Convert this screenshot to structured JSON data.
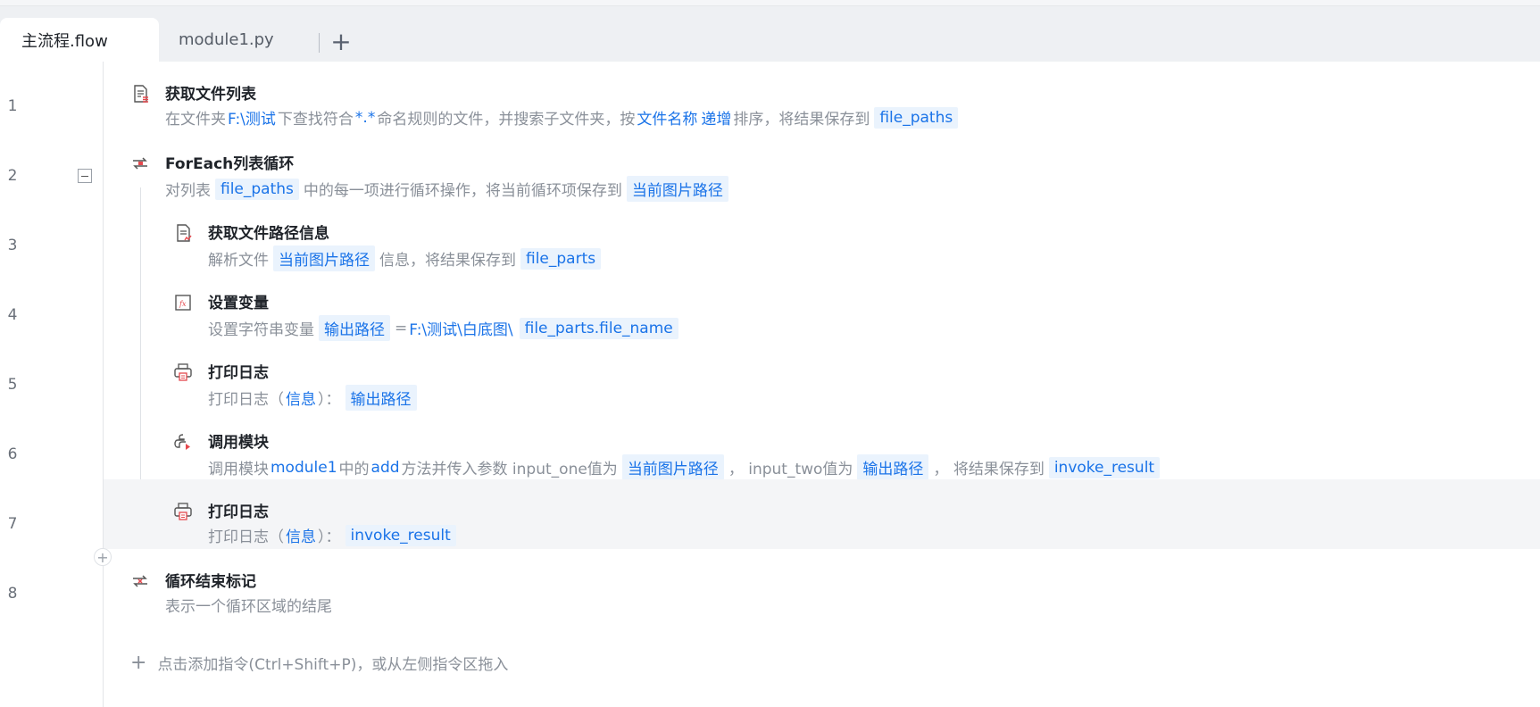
{
  "tabs": [
    {
      "label": "主流程.flow",
      "active": true
    },
    {
      "label": "module1.py",
      "active": false
    }
  ],
  "tab_add_label": "+",
  "colors": {
    "accent": "#1a73e8",
    "var_bg": "#eaf3fd",
    "muted": "#8a9099"
  },
  "steps": [
    {
      "num": "1",
      "icon": "file-list-icon",
      "title": "获取文件列表",
      "desc": [
        [
          "t",
          "在文件夹 "
        ],
        [
          "k",
          "F:\\测试"
        ],
        [
          "t",
          " 下查找符合 "
        ],
        [
          "k",
          "*.*"
        ],
        [
          "t",
          " 命名规则的文件，并搜索子文件夹，按 "
        ],
        [
          "k",
          "文件名称"
        ],
        [
          "k",
          "递增"
        ],
        [
          "t",
          " 排序，将结果保存到 "
        ],
        [
          "v",
          "file_paths"
        ]
      ]
    },
    {
      "num": "2",
      "icon": "loop-icon",
      "title": "ForEach列表循环",
      "desc": [
        [
          "t",
          "对列表 "
        ],
        [
          "v",
          "file_paths"
        ],
        [
          "t",
          " 中的每一项进行循环操作，将当前循环项保存到 "
        ],
        [
          "v",
          "当前图片路径"
        ]
      ]
    },
    {
      "num": "3",
      "icon": "file-path-icon",
      "title": "获取文件路径信息",
      "desc": [
        [
          "t",
          "解析文件 "
        ],
        [
          "v",
          "当前图片路径"
        ],
        [
          "t",
          " 信息，将结果保存到 "
        ],
        [
          "v",
          "file_parts"
        ]
      ]
    },
    {
      "num": "4",
      "icon": "function-icon",
      "title": "设置变量",
      "desc": [
        [
          "t",
          "设置字符串变量 "
        ],
        [
          "v",
          "输出路径"
        ],
        [
          "t",
          " = "
        ],
        [
          "k",
          "F:\\测试\\白底图\\"
        ],
        [
          "v",
          "file_parts.file_name"
        ]
      ]
    },
    {
      "num": "5",
      "icon": "print-log-icon",
      "title": "打印日志",
      "desc": [
        [
          "t",
          "打印日志（ "
        ],
        [
          "k",
          "信息"
        ],
        [
          "t",
          " ）： "
        ],
        [
          "v",
          "输出路径"
        ]
      ]
    },
    {
      "num": "6",
      "icon": "python-module-icon",
      "title": "调用模块",
      "desc": [
        [
          "t",
          "调用模块 "
        ],
        [
          "k",
          "module1"
        ],
        [
          "t",
          " 中的 "
        ],
        [
          "k",
          "add"
        ],
        [
          "t",
          " 方法并传入参数 input_one值为 "
        ],
        [
          "v",
          "当前图片路径"
        ],
        [
          "t",
          " ，  input_two值为 "
        ],
        [
          "v",
          "输出路径"
        ],
        [
          "t",
          " ，  将结果保存到 "
        ],
        [
          "v",
          "invoke_result"
        ]
      ]
    },
    {
      "num": "7",
      "icon": "print-log-icon",
      "title": "打印日志",
      "desc": [
        [
          "t",
          "打印日志（ "
        ],
        [
          "k",
          "信息"
        ],
        [
          "t",
          " ）： "
        ],
        [
          "v",
          "invoke_result"
        ]
      ]
    },
    {
      "num": "8",
      "icon": "loop-end-icon",
      "title": "循环结束标记",
      "desc": [
        [
          "t",
          "表示一个循环区域的结尾"
        ]
      ]
    }
  ],
  "add_hint": "点击添加指令(Ctrl+Shift+P)，或从左侧指令区拖入"
}
